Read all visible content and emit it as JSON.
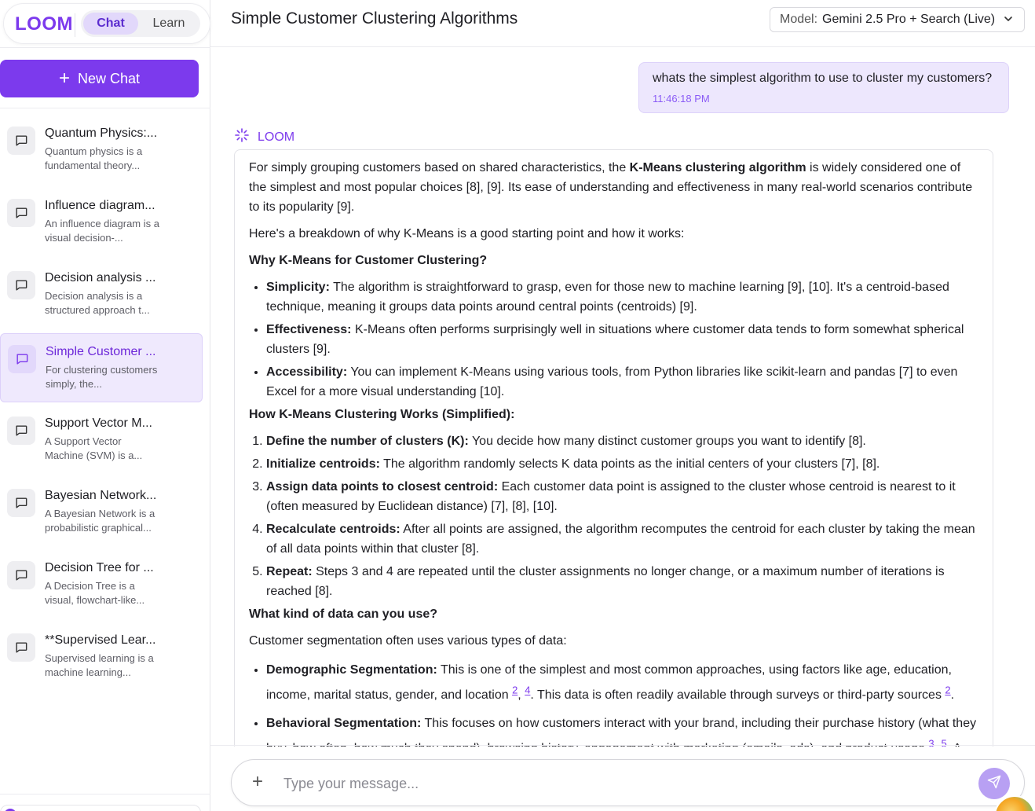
{
  "app": {
    "logo": "LOOM",
    "modes": {
      "chat": "Chat",
      "learn": "Learn"
    }
  },
  "sidebar": {
    "new_chat_label": "New Chat",
    "conversations": [
      {
        "title": "Quantum Physics:...",
        "snippet": "Quantum physics is a fundamental theory...",
        "active": false
      },
      {
        "title": "Influence diagram...",
        "snippet": "An influence diagram is a visual decision-...",
        "active": false
      },
      {
        "title": "Decision analysis ...",
        "snippet": "Decision analysis is a structured approach t...",
        "active": false
      },
      {
        "title": "Simple Customer ...",
        "snippet": "For clustering customers simply, the...",
        "active": true
      },
      {
        "title": "Support Vector M...",
        "snippet": "A Support Vector Machine (SVM) is a...",
        "active": false
      },
      {
        "title": "Bayesian Network...",
        "snippet": "A Bayesian Network is a probabilistic graphical...",
        "active": false
      },
      {
        "title": "Decision Tree for ...",
        "snippet": "A Decision Tree is a visual, flowchart-like...",
        "active": false
      },
      {
        "title": "**Supervised Lear...",
        "snippet": "Supervised learning is a machine learning...",
        "active": false
      }
    ]
  },
  "header": {
    "title": "Simple Customer Clustering Algorithms",
    "model_label": "Model:",
    "model_value": "Gemini 2.5 Pro + Search (Live)"
  },
  "chat": {
    "user_message": "whats the simplest algorithm to use to cluster my customers?",
    "user_time": "11:46:18 PM",
    "ai_name": "LOOM",
    "intro_pre": "For simply grouping customers based on shared characteristics, the ",
    "intro_bold": "K-Means clustering algorithm",
    "intro_post": " is widely considered one of the simplest and most popular choices [8], [9]. Its ease of understanding and effectiveness in many real-world scenarios contribute to its popularity [9].",
    "breakdown": "Here's a breakdown of why K-Means is a good starting point and how it works:",
    "why_heading": "Why K-Means for Customer Clustering?",
    "why_items": [
      {
        "term": "Simplicity:",
        "text": " The algorithm is straightforward to grasp, even for those new to machine learning [9], [10]. It's a centroid-based technique, meaning it groups data points around central points (centroids) [9]."
      },
      {
        "term": "Effectiveness:",
        "text": " K-Means often performs surprisingly well in situations where customer data tends to form somewhat spherical clusters [9]."
      },
      {
        "term": "Accessibility:",
        "text": " You can implement K-Means using various tools, from Python libraries like scikit-learn and pandas [7] to even Excel for a more visual understanding [10]."
      }
    ],
    "how_heading": "How K-Means Clustering Works (Simplified):",
    "how_items": [
      {
        "term": "Define the number of clusters (K):",
        "text": " You decide how many distinct customer groups you want to identify [8]."
      },
      {
        "term": "Initialize centroids:",
        "text": " The algorithm randomly selects K data points as the initial centers of your clusters [7], [8]."
      },
      {
        "term": "Assign data points to closest centroid:",
        "text": " Each customer data point is assigned to the cluster whose centroid is nearest to it (often measured by Euclidean distance) [7], [8], [10]."
      },
      {
        "term": "Recalculate centroids:",
        "text": " After all points are assigned, the algorithm recomputes the centroid for each cluster by taking the mean of all data points within that cluster [8]."
      },
      {
        "term": "Repeat:",
        "text": " Steps 3 and 4 are repeated until the cluster assignments no longer change, or a maximum number of iterations is reached [8]."
      }
    ],
    "data_heading": "What kind of data can you use?",
    "data_intro": "Customer segmentation often uses various types of data:",
    "demo": {
      "term": "Demographic Segmentation:",
      "text1": " This is one of the simplest and most common approaches, using factors like age, education, income, marital status, gender, and location ",
      "ref1": "2",
      "comma": ", ",
      "ref2": "4",
      "text2": ". This data is often readily available through surveys or third-party sources ",
      "ref3": "2",
      "text3": "."
    },
    "behav": {
      "term": "Behavioral Segmentation:",
      "text1": " This focuses on how customers interact with your brand, including their purchase history (what they buy, how often, how much they spend), browsing history, engagement with marketing (emails, ads), and product usage ",
      "ref1": "3",
      "comma": ", ",
      "ref2": "5",
      "text2": ". A"
    }
  },
  "composer": {
    "placeholder": "Type your message..."
  },
  "colors": {
    "accent": "#7c3aed",
    "accent_light": "#ede7fd"
  }
}
